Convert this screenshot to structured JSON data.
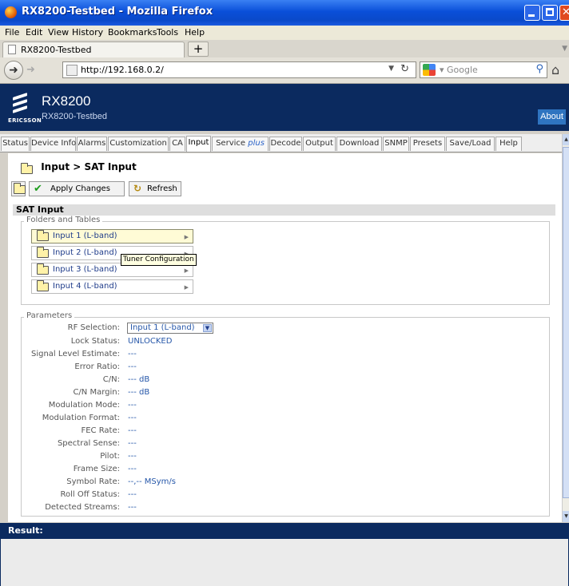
{
  "window": {
    "title": "RX8200-Testbed - Mozilla Firefox"
  },
  "menu": [
    "File",
    "Edit",
    "View",
    "History",
    "Bookmarks",
    "Tools",
    "Help"
  ],
  "browser_tab": {
    "label": "RX8200-Testbed",
    "new_tab": "+"
  },
  "nav": {
    "url": "http://192.168.0.2/",
    "search_placeholder": "Google"
  },
  "header": {
    "logo_text": "ERICSSON",
    "product": "RX8200",
    "host": "RX8200-Testbed",
    "about": "About"
  },
  "tabs": [
    {
      "label": "Status"
    },
    {
      "label": "Device Info"
    },
    {
      "label": "Alarms"
    },
    {
      "label": "Customization"
    },
    {
      "label": "CA"
    },
    {
      "label": "Input",
      "active": true
    },
    {
      "label": "Service",
      "suffix": "plus"
    },
    {
      "label": "Decode"
    },
    {
      "label": "Output"
    },
    {
      "label": "Download"
    },
    {
      "label": "SNMP"
    },
    {
      "label": "Presets"
    },
    {
      "label": "Save/Load"
    },
    {
      "label": "Help"
    }
  ],
  "breadcrumb": "Input > SAT Input",
  "toolbar": {
    "apply": "Apply Changes",
    "refresh": "Refresh"
  },
  "section_title": "SAT Input",
  "folders": {
    "legend": "Folders and Tables",
    "items": [
      "Input 1 (L-band)",
      "Input 2 (L-band)",
      "Input 3 (L-band)",
      "Input 4 (L-band)"
    ]
  },
  "tooltip": "Tuner Configuration",
  "parameters": {
    "legend": "Parameters",
    "rf_selection": {
      "label": "RF Selection:",
      "value": "Input 1 (L-band)"
    },
    "rows": [
      {
        "label": "Lock Status:",
        "value": "UNLOCKED"
      },
      {
        "label": "Signal Level Estimate:",
        "value": "---"
      },
      {
        "label": "Error Ratio:",
        "value": "---"
      },
      {
        "label": "C/N:",
        "value": "--- dB"
      },
      {
        "label": "C/N Margin:",
        "value": "--- dB"
      },
      {
        "label": "Modulation Mode:",
        "value": "---"
      },
      {
        "label": "Modulation Format:",
        "value": "---"
      },
      {
        "label": "FEC Rate:",
        "value": "---"
      },
      {
        "label": "Spectral Sense:",
        "value": "---"
      },
      {
        "label": "Pilot:",
        "value": "---"
      },
      {
        "label": "Frame Size:",
        "value": "---"
      },
      {
        "label": "Symbol Rate:",
        "value": "--,-- MSym/s"
      },
      {
        "label": "Roll Off Status:",
        "value": "---"
      },
      {
        "label": "Detected Streams:",
        "value": "---"
      }
    ]
  },
  "result": {
    "label": "Result:"
  }
}
